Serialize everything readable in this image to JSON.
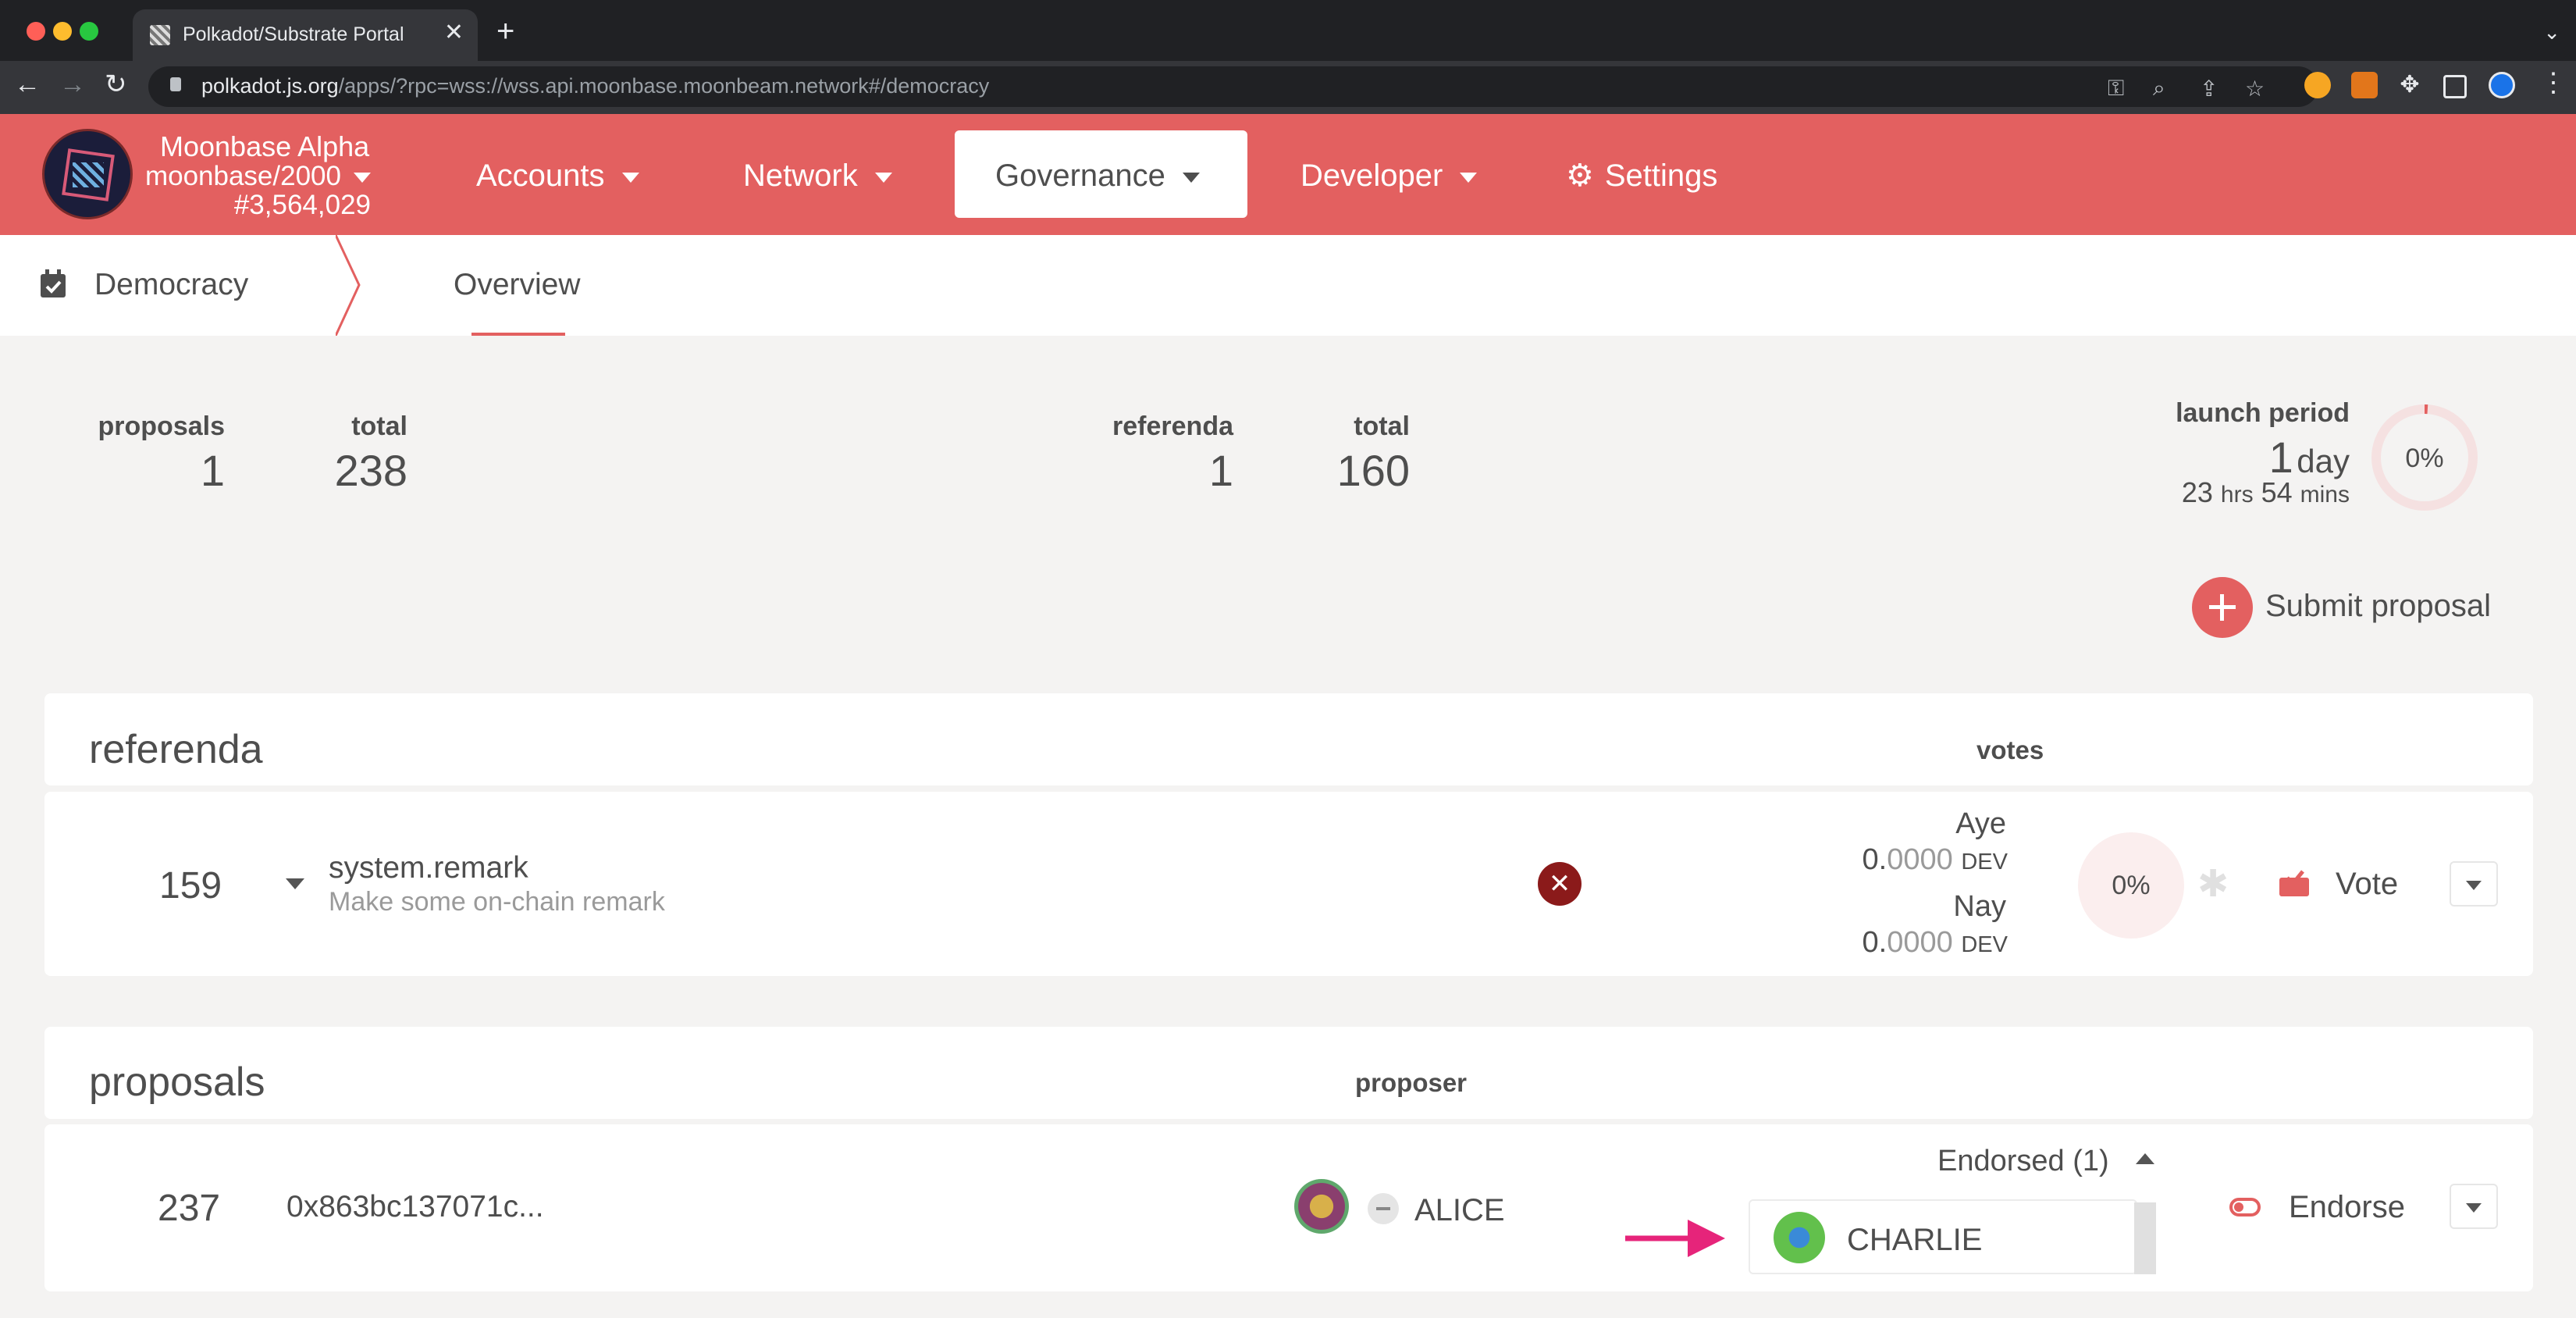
{
  "browser": {
    "tab_title": "Polkadot/Substrate Portal",
    "tab_close": "✕",
    "new_tab": "+",
    "url_host": "polkadot.js.org",
    "url_path": "/apps/?rpc=wss://wss.api.moonbase.moonbeam.network#/democracy"
  },
  "chain": {
    "name": "Moonbase Alpha",
    "spec": "moonbase/2000",
    "block": "#3,564,029"
  },
  "menu": {
    "accounts": "Accounts",
    "network": "Network",
    "governance": "Governance",
    "developer": "Developer",
    "settings": "Settings"
  },
  "subnav": {
    "section": "Democracy",
    "tab": "Overview"
  },
  "summary": {
    "proposals_label": "proposals",
    "proposals_value": "1",
    "proposals_total_label": "total",
    "proposals_total_value": "238",
    "referenda_label": "referenda",
    "referenda_value": "1",
    "referenda_total_label": "total",
    "referenda_total_value": "160",
    "launch_label": "launch period",
    "launch_days": "1",
    "launch_days_unit": "day",
    "launch_hrs": "23",
    "launch_hrs_unit": "hrs",
    "launch_mins": "54",
    "launch_mins_unit": "mins",
    "launch_percent": "0%",
    "launch_progress": 0.01
  },
  "submit_proposal": {
    "label": "Submit proposal",
    "icon": "plus-icon"
  },
  "referenda": {
    "title": "referenda",
    "votes_header": "votes",
    "row": {
      "index": "159",
      "call": "system.remark",
      "description": "Make some on-chain remark",
      "aye_label": "Aye",
      "aye_whole": "0.",
      "aye_frac": "0000",
      "aye_unit": "DEV",
      "nay_label": "Nay",
      "nay_whole": "0.",
      "nay_frac": "0000",
      "nay_unit": "DEV",
      "percent": "0%",
      "vote_label": "Vote",
      "status_icon": "close-icon",
      "status_color": "#8b1a1a"
    }
  },
  "proposals": {
    "title": "proposals",
    "proposer_header": "proposer",
    "row": {
      "index": "237",
      "hash": "0x863bc137071c...",
      "proposer": "ALICE",
      "endorsed": "Endorsed (1)",
      "endorser": "CHARLIE",
      "endorse_label": "Endorse"
    }
  },
  "colors": {
    "accent": "#e36060",
    "annotation_arrow": "#e6247a"
  }
}
